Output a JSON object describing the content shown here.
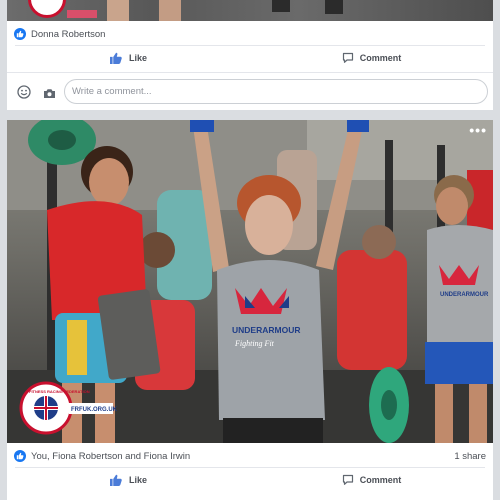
{
  "top_post": {
    "reactions_text": "Donna Robertson",
    "like_label": "Like",
    "comment_label": "Comment",
    "comment_placeholder": "Write a comment..."
  },
  "main_post": {
    "shirt_brand": "UNDERARMOUR",
    "shirt_text": "Fighting Fit",
    "right_shirt_text": "UNDERARMOUR",
    "logo_text": "FITNESS RACING FEDERATION",
    "logo_url": "FRFUK.ORG.UK",
    "reactions_text": "You, Fiona Robertson and Fiona Irwin",
    "share_count": "1 share",
    "like_label": "Like",
    "comment_label": "Comment"
  },
  "colors": {
    "facebook_blue": "#1877f2",
    "red_shirt": "#d8282a"
  }
}
